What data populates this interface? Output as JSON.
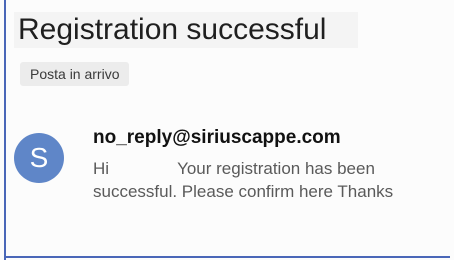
{
  "email": {
    "subject": "Registration successful",
    "label": "Posta in arrivo",
    "sender_initial": "S",
    "sender_address": "no_reply@siriuscappe.com",
    "preview_greeting": "Hi",
    "preview_line1": "Your registration has been",
    "preview_line2": "successful. Please confirm here Thanks"
  },
  "colors": {
    "avatar": "#5f86c8",
    "frame_border": "#4a67b8"
  }
}
